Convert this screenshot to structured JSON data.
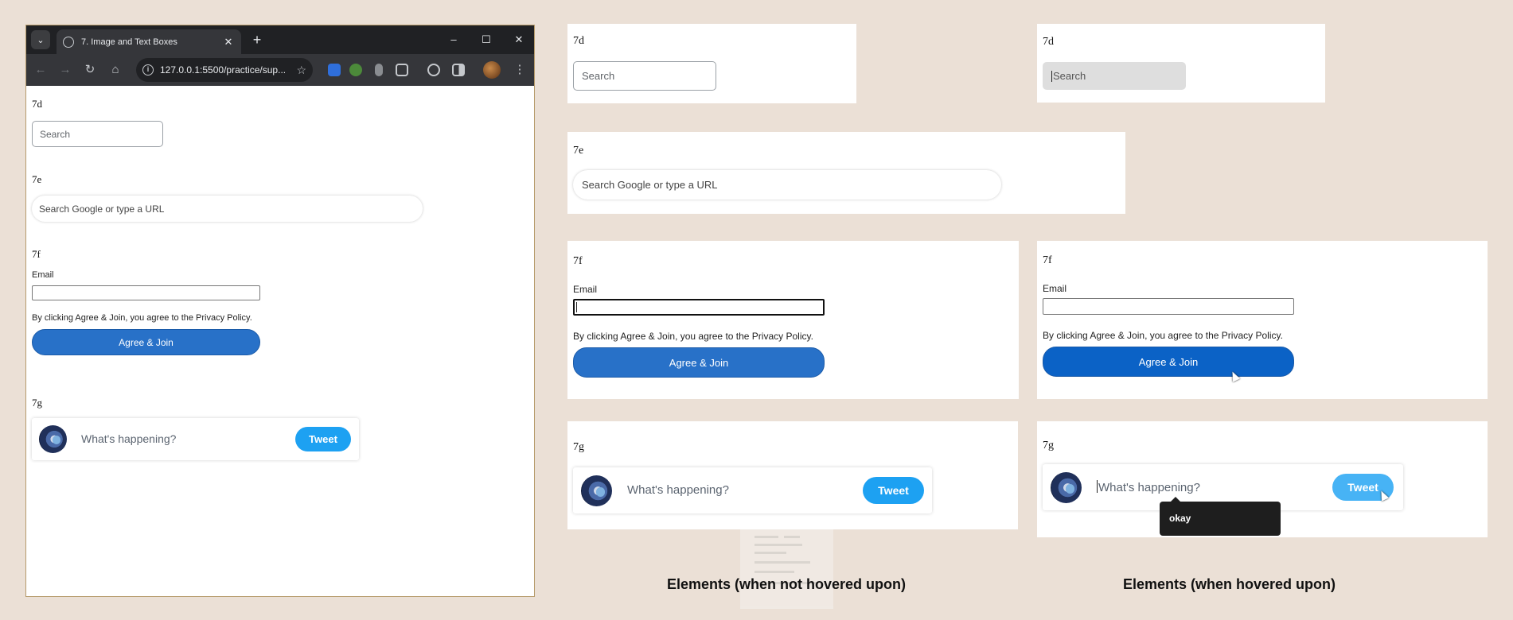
{
  "browser": {
    "tab_title": "7. Image and Text Boxes",
    "new_tab": "+",
    "close_tab": "✕",
    "url": "127.0.0.1:5500/practice/sup...",
    "window_controls": {
      "minimize": "–",
      "maximize": "☐",
      "close": "✕"
    },
    "nav": {
      "back": "←",
      "forward": "→",
      "reload": "↻",
      "home": "⌂",
      "star": "☆",
      "menu": "⋮"
    }
  },
  "sections": {
    "s7d": {
      "label": "7d",
      "placeholder": "Search"
    },
    "s7e": {
      "label": "7e",
      "placeholder": "Search Google or type a URL"
    },
    "s7f": {
      "label": "7f",
      "email_label": "Email",
      "email_value": "",
      "policy": "By clicking Agree & Join, you agree to the Privacy Policy.",
      "button": "Agree & Join"
    },
    "s7g": {
      "label": "7g",
      "placeholder": "What's happening?",
      "button": "Tweet",
      "tooltip": "okay"
    }
  },
  "captions": {
    "not_hovered": "Elements (when not hovered upon)",
    "hovered": "Elements (when hovered upon)"
  },
  "colors": {
    "background": "#ebe0d6",
    "agree_button": "#2871c8",
    "agree_button_hover": "#0b62c6",
    "tweet_button": "#1da1f2",
    "tweet_button_hover": "#47b3f5",
    "search_hover_bg": "#dedede",
    "tooltip_bg": "#1e1e1e"
  }
}
